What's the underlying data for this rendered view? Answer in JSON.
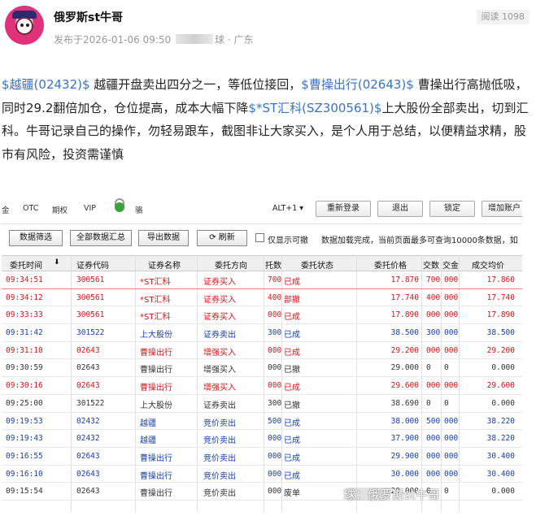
{
  "author": {
    "name": "俄罗斯st牛哥"
  },
  "meta": {
    "published": "发布于2026-01-06 09:50",
    "suffix": "球",
    "separator": "·",
    "location": "广东"
  },
  "views": {
    "label": "阅读",
    "count": "1098"
  },
  "post": {
    "tag1": "$越疆(02432)$",
    "text1": " 越疆开盘卖出四分之一，等低位接回，",
    "tag2": "$曹操出行(02643)$",
    "text2": " 曹操出行高抛低吸，同时29.2翻倍加仓，仓位提高，成本大幅下降",
    "tag3": "$*ST汇科(SZ300561)$",
    "text3": "上大股份全部卖出，切到汇科。牛哥记录自己的操作，勿轻易跟车，截图非让大家买入，是个人用于总结，以便精益求精，股市有风险，投资需谨慎"
  },
  "window": {
    "nav": [
      "金",
      "OTC",
      "期权",
      "VIP"
    ],
    "user": "骆",
    "alt": "ALT+1 ▾",
    "top_buttons": [
      "重新登录",
      "退出",
      "锁定",
      "增加账户"
    ],
    "toolbar": {
      "filter": "数据筛选",
      "summary": "全部数据汇总",
      "export": "导出数据",
      "refresh": "⟳ 刷新",
      "only_cancelable": "仅显示可撤",
      "note": "数据加载完成，当前页面最多可查询10000条数据，如"
    },
    "columns": [
      "委托时间",
      "证券代码",
      "证券名称",
      "委托方向",
      "托数",
      "委托状态",
      "委托价格",
      "交数",
      "交金",
      "成交均价"
    ],
    "rows": [
      {
        "time": "09:34:51",
        "code": "300561",
        "name": "*ST汇科",
        "dir": "证券买入",
        "cnt": "700",
        "status": "已成",
        "price": "17.870",
        "deal": "700",
        "amt": "000",
        "avg": "17.860",
        "color": "red",
        "sel": true
      },
      {
        "time": "09:34:12",
        "code": "300561",
        "name": "*ST汇科",
        "dir": "证券买入",
        "cnt": "400",
        "status": "部撤",
        "price": "17.740",
        "deal": "400",
        "amt": "000",
        "avg": "17.740",
        "color": "red"
      },
      {
        "time": "09:33:33",
        "code": "300561",
        "name": "*ST汇科",
        "dir": "证券买入",
        "cnt": "000",
        "status": "已成",
        "price": "17.890",
        "deal": "000",
        "amt": "000",
        "avg": "17.890",
        "color": "red"
      },
      {
        "time": "09:31:42",
        "code": "301522",
        "name": "上大股份",
        "dir": "证券卖出",
        "cnt": "300",
        "status": "已成",
        "price": "38.500",
        "deal": "300",
        "amt": "000",
        "avg": "38.500",
        "color": "blue"
      },
      {
        "time": "09:31:10",
        "code": "02643",
        "name": "曹操出行",
        "dir": "增强买入",
        "cnt": "000",
        "status": "已成",
        "price": "29.200",
        "deal": "000",
        "amt": "000",
        "avg": "29.200",
        "color": "red"
      },
      {
        "time": "09:30:59",
        "code": "02643",
        "name": "曹操出行",
        "dir": "增强买入",
        "cnt": "000",
        "status": "已撤",
        "price": "29.000",
        "deal": "0",
        "amt": "0",
        "avg": "0.000",
        "color": "gray"
      },
      {
        "time": "09:30:16",
        "code": "02643",
        "name": "曹操出行",
        "dir": "增强买入",
        "cnt": "000",
        "status": "已成",
        "price": "29.600",
        "deal": "000",
        "amt": "000",
        "avg": "29.600",
        "color": "red"
      },
      {
        "time": "09:25:00",
        "code": "301522",
        "name": "上大股份",
        "dir": "证券卖出",
        "cnt": "300",
        "status": "已撤",
        "price": "38.690",
        "deal": "0",
        "amt": "0",
        "avg": "0.000",
        "color": "gray"
      },
      {
        "time": "09:19:53",
        "code": "02432",
        "name": "越疆",
        "dir": "竞价卖出",
        "cnt": "500",
        "status": "已成",
        "price": "38.000",
        "deal": "500",
        "amt": "000",
        "avg": "38.220",
        "color": "blue"
      },
      {
        "time": "09:19:43",
        "code": "02432",
        "name": "越疆",
        "dir": "竞价卖出",
        "cnt": "000",
        "status": "已成",
        "price": "37.900",
        "deal": "000",
        "amt": "000",
        "avg": "38.220",
        "color": "blue"
      },
      {
        "time": "09:16:55",
        "code": "02643",
        "name": "曹操出行",
        "dir": "竞价卖出",
        "cnt": "000",
        "status": "已成",
        "price": "29.900",
        "deal": "000",
        "amt": "000",
        "avg": "30.400",
        "color": "blue"
      },
      {
        "time": "09:16:10",
        "code": "02643",
        "name": "曹操出行",
        "dir": "竞价卖出",
        "cnt": "000",
        "status": "已成",
        "price": "30.000",
        "deal": "000",
        "amt": "000",
        "avg": "30.400",
        "color": "blue"
      },
      {
        "time": "09:15:54",
        "code": "02643",
        "name": "曹操出行",
        "dir": "竞价卖出",
        "cnt": "000",
        "status": "废单",
        "price": "29.000",
        "deal": "0",
        "amt": "0",
        "avg": "0.000",
        "color": "gray"
      }
    ]
  },
  "watermark": {
    "text": "球：俄罗斯st牛哥"
  },
  "colors": {
    "buy": "#cc1a1a",
    "sell": "#1a3fa8",
    "tag": "#3a73c7"
  }
}
